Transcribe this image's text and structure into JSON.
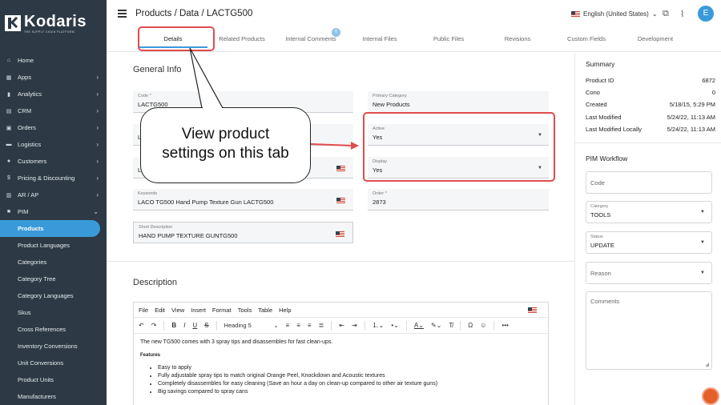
{
  "sidebar": {
    "logo_name": "Kodaris",
    "logo_tagline": "THE SUPPLY CHAIN PLATFORM",
    "items": [
      {
        "label": "Home",
        "icon": "home-icon"
      },
      {
        "label": "Apps",
        "icon": "apps-icon"
      },
      {
        "label": "Analytics",
        "icon": "analytics-icon"
      },
      {
        "label": "CRM",
        "icon": "crm-icon"
      },
      {
        "label": "Orders",
        "icon": "orders-icon"
      },
      {
        "label": "Logistics",
        "icon": "truck-icon"
      },
      {
        "label": "Customers",
        "icon": "customers-icon"
      },
      {
        "label": "Pricing & Discounting",
        "icon": "dollar-icon"
      },
      {
        "label": "AR / AP",
        "icon": "ar-ap-icon"
      },
      {
        "label": "PIM",
        "icon": "pim-icon"
      }
    ],
    "pim_items": [
      "Products",
      "Product Languages",
      "Categories",
      "Category Tree",
      "Category Languages",
      "Skus",
      "Cross References",
      "Inventory Conversions",
      "Unit Conversions",
      "Product Units",
      "Manufacturers"
    ]
  },
  "header": {
    "breadcrumb": "Products / Data / LACTG500",
    "language": "English (United States)",
    "avatar_initial": "E"
  },
  "tabs": [
    {
      "label": "Details"
    },
    {
      "label": "Related Products"
    },
    {
      "label": "Internal Comments",
      "badge": "0"
    },
    {
      "label": "Internal Files"
    },
    {
      "label": "Public Files"
    },
    {
      "label": "Revisions"
    },
    {
      "label": "Custom Fields"
    },
    {
      "label": "Development"
    }
  ],
  "general_info": {
    "title": "General Info",
    "code": {
      "label": "Code *",
      "value": "LACTG500"
    },
    "primary_category": {
      "label": "Primary Category",
      "value": "New Products"
    },
    "active": {
      "label": "Active",
      "value": "Yes"
    },
    "display": {
      "label": "Display",
      "value": "Yes"
    },
    "keywords": {
      "label": "Keywords",
      "value": "LACO TG500 Hand Pump Texture Gun LACTG500"
    },
    "order": {
      "label": "Order *",
      "value": "2873"
    },
    "short_description": {
      "label": "Short Description",
      "value": "HAND PUMP TEXTURE GUNTG500"
    },
    "partial_left_1": "L",
    "partial_left_2": "L"
  },
  "description": {
    "title": "Description",
    "menu": [
      "File",
      "Edit",
      "View",
      "Insert",
      "Format",
      "Tools",
      "Table",
      "Help"
    ],
    "block_format": "Heading 5",
    "intro": "The new TG500 comes with 3 spray tips and disassembles for fast clean-ups.",
    "features_heading": "Features",
    "bullets": [
      "Easy to apply",
      "Fully adjustable spray tips to match original Orange Peel, Knockdown and Acoustic textures",
      "Completely disassembles for easy cleaning (Save an hour a day on clean-up compared to other air texture guns)",
      "Big savings compared to spray cans"
    ]
  },
  "summary": {
    "title": "Summary",
    "rows": [
      {
        "label": "Product ID",
        "value": "6872"
      },
      {
        "label": "Cono",
        "value": "0"
      },
      {
        "label": "Created",
        "value": "5/18/15, 5:29 PM"
      },
      {
        "label": "Last Modified",
        "value": "5/24/22, 11:13 AM"
      },
      {
        "label": "Last Modified Locally",
        "value": "5/24/22, 11:13 AM"
      }
    ]
  },
  "workflow": {
    "title": "PIM Workflow",
    "code_placeholder": "Code",
    "category": {
      "label": "Category",
      "value": "TOOLS"
    },
    "status": {
      "label": "Status",
      "value": "UPDATE"
    },
    "reason_placeholder": "Reason",
    "comments_placeholder": "Comments"
  },
  "annotation": {
    "callout_line1": "View product",
    "callout_line2": "settings on this tab",
    "highlight_color": "#e24b4b"
  }
}
